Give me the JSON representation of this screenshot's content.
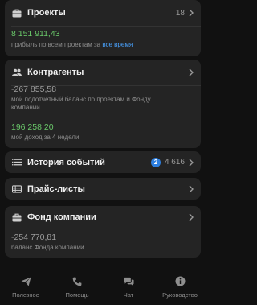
{
  "projects": {
    "title": "Проекты",
    "count": "18",
    "profit_value": "8 151 911,43",
    "profit_caption": "прибыль по всем проектам за",
    "period_link": "все время"
  },
  "counterparties": {
    "title": "Контрагенты",
    "balance_value": "-267 855,58",
    "balance_caption": "мой подотчетный баланс по проектам и Фонду компании",
    "income_value": "196 258,20",
    "income_caption": "мой доход за 4 недели"
  },
  "events": {
    "title": "История событий",
    "badge": "2",
    "count": "4 616"
  },
  "price_lists": {
    "title": "Прайс-листы"
  },
  "fund": {
    "title": "Фонд компании",
    "balance_value": "-254 770,81",
    "balance_caption": "баланс Фонда компании"
  },
  "tabbar": [
    {
      "label": "Полезное",
      "icon": "send-icon"
    },
    {
      "label": "Помощь",
      "icon": "phone-icon"
    },
    {
      "label": "Чат",
      "icon": "chat-icon"
    },
    {
      "label": "Руководство",
      "icon": "info-icon"
    }
  ],
  "colors": {
    "background": "#111111",
    "card": "#242424",
    "positive": "#6ac86a",
    "link": "#4aa3ff",
    "badge": "#2d7fe0"
  }
}
